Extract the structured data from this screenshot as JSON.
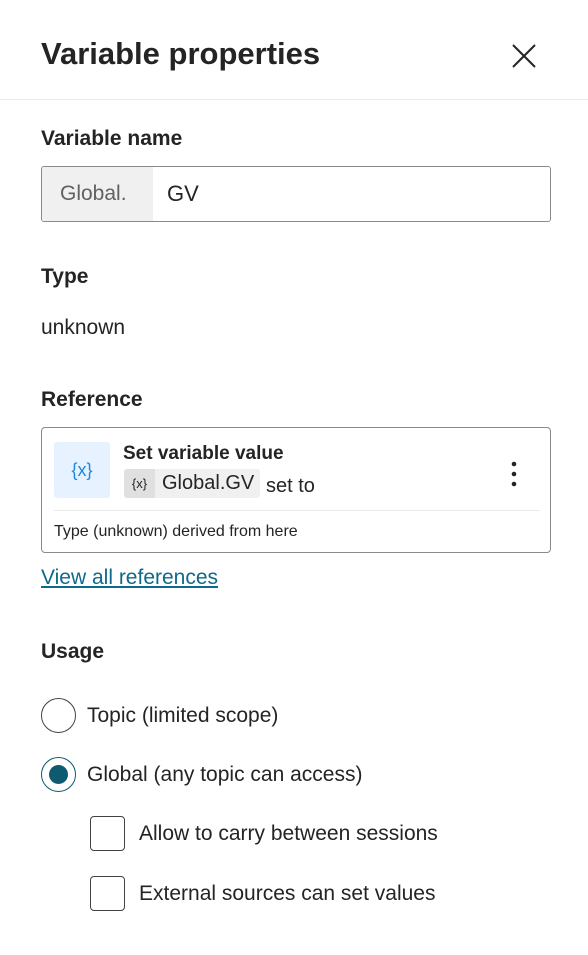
{
  "header": {
    "title": "Variable properties",
    "close_icon": "close-icon"
  },
  "variable_name": {
    "label": "Variable name",
    "prefix": "Global.",
    "value": "GV"
  },
  "type": {
    "label": "Type",
    "value": "unknown"
  },
  "reference": {
    "label": "Reference",
    "card": {
      "icon": "{x}",
      "title": "Set variable value",
      "chip_icon": "{x}",
      "chip_text": "Global.GV",
      "suffix": "set to",
      "footer": "Type (unknown) derived from here"
    },
    "view_all": "View all references"
  },
  "usage": {
    "label": "Usage",
    "options": [
      {
        "label": "Topic (limited scope)",
        "selected": false
      },
      {
        "label": "Global (any topic can access)",
        "selected": true
      }
    ],
    "checkboxes": [
      {
        "label": "Allow to carry between sessions",
        "checked": false
      },
      {
        "label": "External sources can set values",
        "checked": false
      }
    ]
  },
  "colors": {
    "accent": "#0e5a6e",
    "link": "#0e6a8c",
    "icon_bg": "#e6f2ff",
    "icon": "#1f86e0"
  }
}
